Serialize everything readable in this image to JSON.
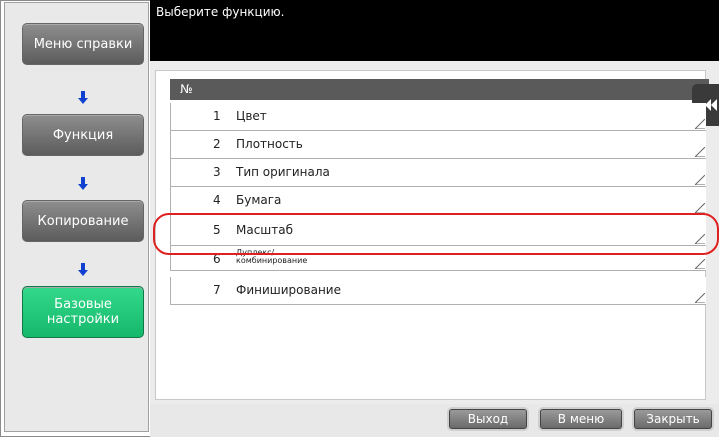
{
  "header": {
    "prompt": "Выберите функцию."
  },
  "sidebar": {
    "items": [
      {
        "label": "Меню справки",
        "active": false
      },
      {
        "label": "Функция",
        "active": false
      },
      {
        "label": "Копирование",
        "active": false
      },
      {
        "label": "Базовые настройки",
        "active": true
      }
    ],
    "arrow_icon": "arrow-down-icon"
  },
  "list": {
    "header": "№",
    "rows": [
      {
        "num": "1",
        "label": "Цвет"
      },
      {
        "num": "2",
        "label": "Плотность"
      },
      {
        "num": "3",
        "label": "Тип оригинала"
      },
      {
        "num": "4",
        "label": "Бумага"
      },
      {
        "num": "5",
        "label": "Масштаб"
      },
      {
        "num": "6",
        "label": "Дуплекс/ комбинирование"
      },
      {
        "num": "7",
        "label": "Финиширование"
      }
    ],
    "highlighted_row": "5"
  },
  "footer": {
    "exit_label": "Выход",
    "menu_label": "В меню",
    "close_label": "Закрыть"
  },
  "colors": {
    "active_green": "#22c97a",
    "highlight_red": "#e02020",
    "arrow_blue": "#1040d0"
  }
}
